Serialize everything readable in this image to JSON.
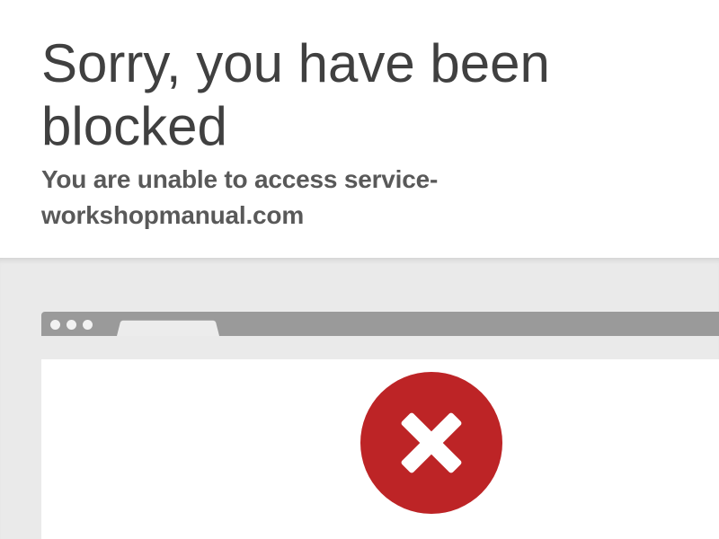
{
  "header": {
    "title": "Sorry, you have been blocked",
    "subtitle": "You are unable to access service-workshopmanual.com"
  },
  "illustration": {
    "browser_dots_count": 3,
    "error_icon": "error-x-icon",
    "colors": {
      "background": "#eaeaea",
      "browser_bar": "#9a9a9a",
      "error": "#bd2426"
    }
  }
}
